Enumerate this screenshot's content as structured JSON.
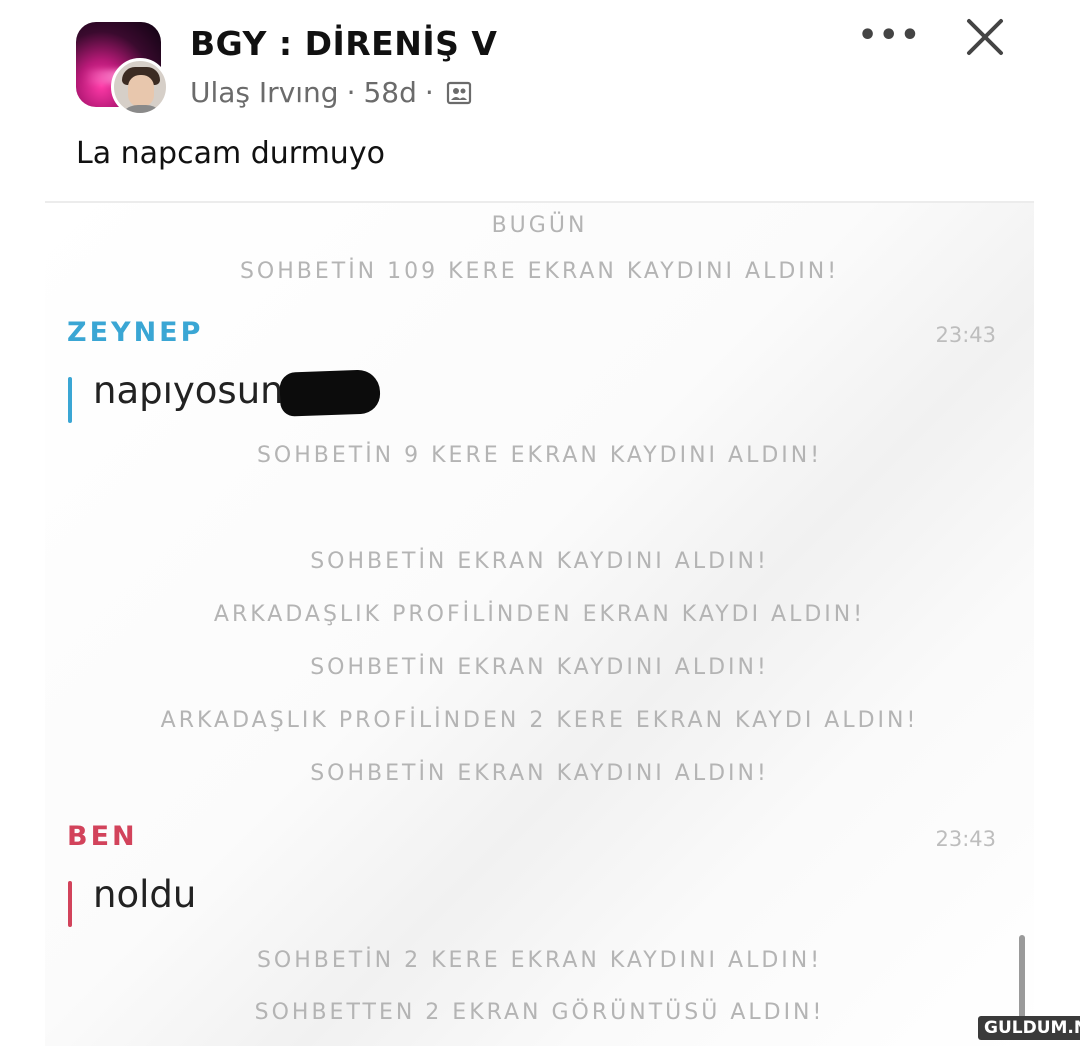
{
  "post": {
    "group_name": "BGY : DİRENİŞ V",
    "author": "Ulaş Irvıng",
    "separator": "·",
    "age": "58d",
    "privacy_icon": "group-members-icon",
    "more_icon": "•••",
    "caption": "La napcam durmuyo"
  },
  "chat": {
    "notices_top": [
      "BUGÜN",
      "SOHBETİN 109 KERE EKRAN KAYDINI ALDIN!"
    ],
    "message1": {
      "sender": "ZEYNEP",
      "time": "23:43",
      "text": "napıyosun",
      "sender_color": "#3aa6d4"
    },
    "notices_middle": [
      "SOHBETİN 9 KERE EKRAN KAYDINI ALDIN!",
      "SOHBETİN EKRAN KAYDINI ALDIN!",
      "ARKADAŞLIK PROFİLİNDEN EKRAN KAYDI ALDIN!",
      "SOHBETİN EKRAN KAYDINI ALDIN!",
      "ARKADAŞLIK PROFİLİNDEN 2 KERE EKRAN KAYDI ALDIN!",
      "SOHBETİN EKRAN KAYDINI ALDIN!"
    ],
    "message2": {
      "sender": "BEN",
      "time": "23:43",
      "text": "noldu",
      "sender_color": "#d2435b"
    },
    "notices_bottom": [
      "SOHBETİN 2 KERE EKRAN KAYDINI ALDIN!",
      "SOHBETTEN 2 EKRAN GÖRÜNTÜSÜ ALDIN!"
    ]
  },
  "watermark": "GULDUM.NET"
}
